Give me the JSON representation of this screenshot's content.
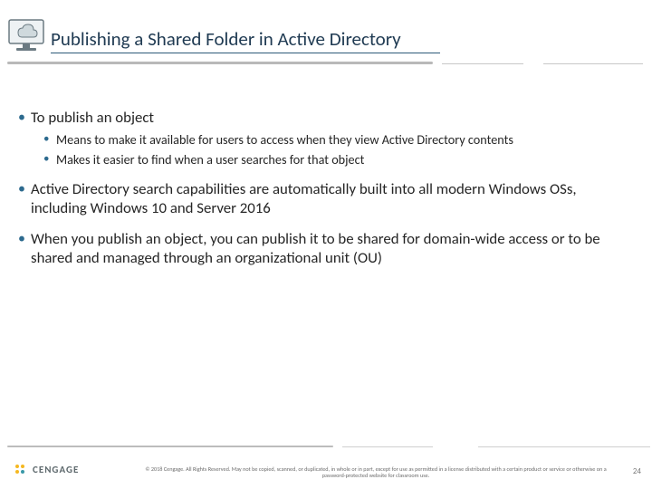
{
  "header": {
    "title": "Publishing a Shared Folder in Active Directory",
    "icon": "cloud-monitor-icon"
  },
  "bullets": [
    {
      "text": "To publish an object",
      "sub": [
        "Means to make it available for users to access when they view Active Directory contents",
        "Makes it easier to find when a user searches for that object"
      ]
    },
    {
      "text": "Active Directory search capabilities are automatically built into all modern Windows OSs, including Windows 10 and Server 2016",
      "sub": []
    },
    {
      "text": "When you publish an object, you can publish it to be shared for domain-wide access or to be shared and managed through an organizational unit (OU)",
      "sub": []
    }
  ],
  "footer": {
    "brand": "CENGAGE",
    "copyright": "© 2018 Cengage. All Rights Reserved. May not be copied, scanned, or duplicated, in whole or in part, except for use as permitted in a license distributed with a certain product or service or otherwise on a password-protected website for classroom use.",
    "page": "24"
  }
}
